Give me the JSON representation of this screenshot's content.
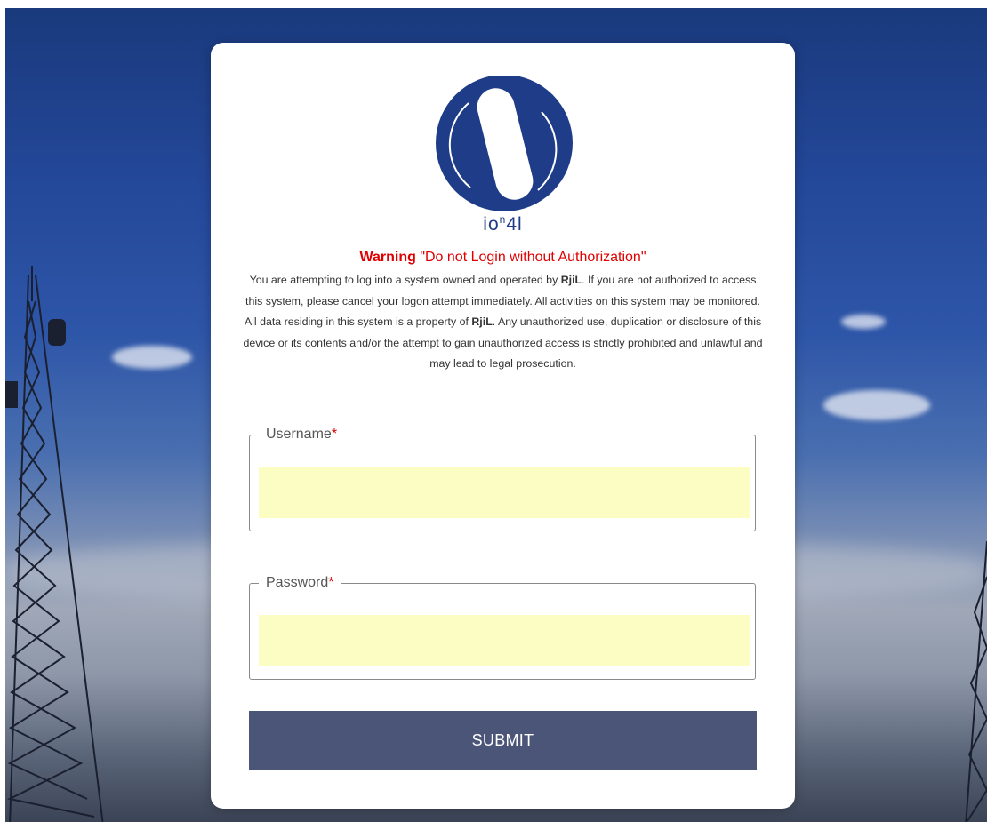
{
  "brand": {
    "name_main": "io",
    "name_sup": "n",
    "name_tail": "4l",
    "logo_icon": "ion4l-logo-icon",
    "color": "#1f3c88"
  },
  "warning": {
    "title_strong": "Warning",
    "title_rest": " \"Do not Login without Authorization\"",
    "body_part1": "You are attempting to log into a system owned and operated by ",
    "company": "RjiL",
    "body_part2": ". If you are not authorized to access this system, please cancel your logon attempt immediately. All activities on this system may be monitored. All data residing in this system is a property of ",
    "company2": "RjiL",
    "body_part3": ". Any unauthorized use, duplication or disclosure of this device or its contents and/or the attempt to gain unauthorized access is strictly prohibited and unlawful and may lead to legal prosecution.",
    "color": "#e00000"
  },
  "form": {
    "username_label": "Username",
    "password_label": "Password",
    "required_mark": "*",
    "username_value": "",
    "password_value": "",
    "field_bg": "#fbfdc2",
    "submit_label": "SUBMIT",
    "submit_bg": "#4a5578"
  }
}
